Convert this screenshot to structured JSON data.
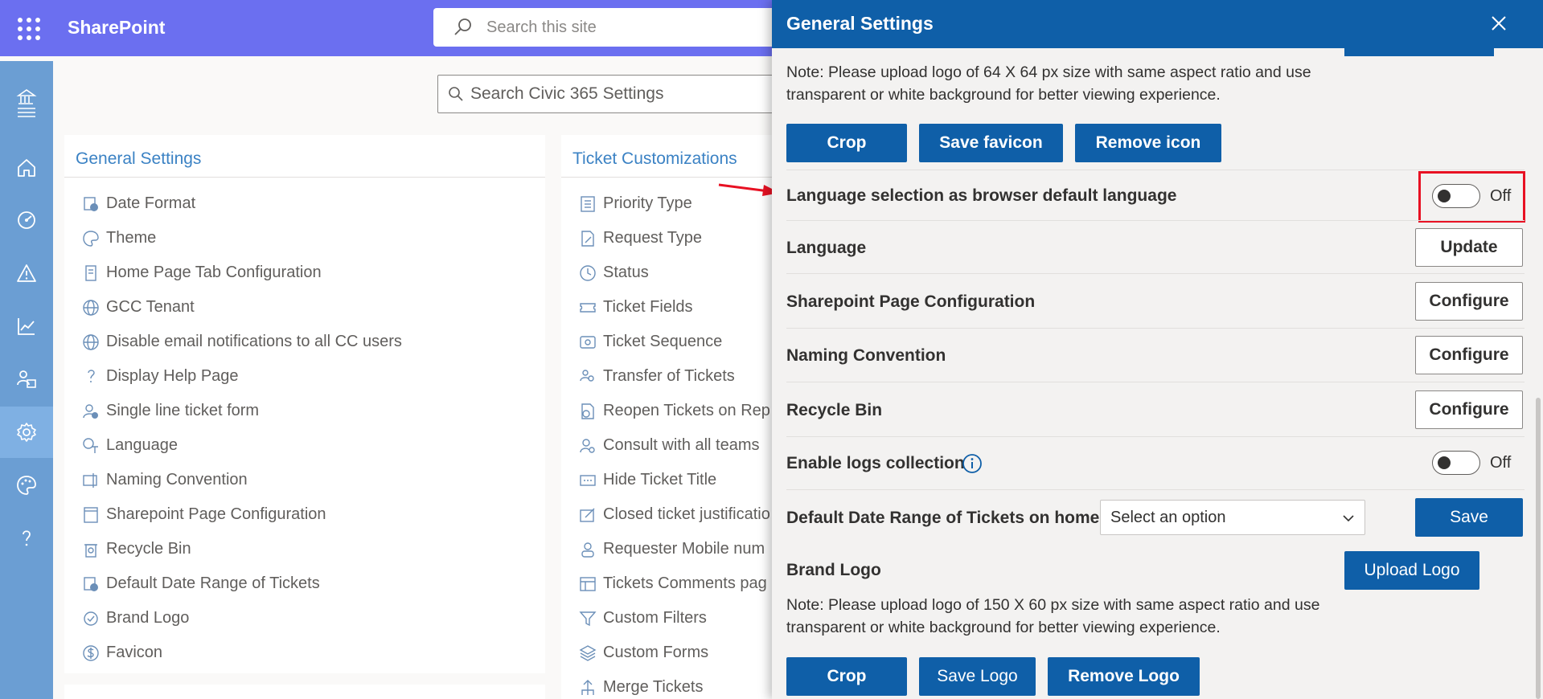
{
  "app": {
    "name": "SharePoint",
    "site_search_placeholder": "Search this site"
  },
  "main": {
    "settings_search_placeholder": "Search Civic 365 Settings",
    "general_card": {
      "title": "General Settings",
      "items": [
        {
          "label": "Date Format",
          "icon": "calendar-clock-icon"
        },
        {
          "label": "Theme",
          "icon": "palette-icon"
        },
        {
          "label": "Home Page Tab Configuration",
          "icon": "document-icon"
        },
        {
          "label": "GCC Tenant",
          "icon": "globe-icon"
        },
        {
          "label": "Disable email notifications to all CC users",
          "icon": "globe-icon"
        },
        {
          "label": "Display Help Page",
          "icon": "question-icon"
        },
        {
          "label": "Single line ticket form",
          "icon": "person-remove-icon"
        },
        {
          "label": "Language",
          "icon": "translate-icon"
        },
        {
          "label": "Naming Convention",
          "icon": "rename-icon"
        },
        {
          "label": "Sharepoint Page Configuration",
          "icon": "page-icon"
        },
        {
          "label": "Recycle Bin",
          "icon": "recycle-icon"
        },
        {
          "label": "Default Date Range of Tickets",
          "icon": "calendar-clock-icon"
        },
        {
          "label": "Brand Logo",
          "icon": "badge-icon"
        },
        {
          "label": "Favicon",
          "icon": "dollar-icon"
        }
      ]
    },
    "ticket_card": {
      "title": "Ticket Customizations",
      "items": [
        {
          "label": "Priority Type",
          "icon": "list-icon"
        },
        {
          "label": "Request Type",
          "icon": "edit-document-icon"
        },
        {
          "label": "Status",
          "icon": "clock-icon"
        },
        {
          "label": "Ticket Fields",
          "icon": "ticket-icon"
        },
        {
          "label": "Ticket Sequence",
          "icon": "number-icon"
        },
        {
          "label": "Transfer of Tickets",
          "icon": "people-swap-icon"
        },
        {
          "label": "Reopen Tickets on Rep",
          "icon": "reopen-icon"
        },
        {
          "label": "Consult with all teams",
          "icon": "person-search-icon"
        },
        {
          "label": "Hide Ticket Title",
          "icon": "dots-box-icon"
        },
        {
          "label": "Closed ticket justificatio",
          "icon": "edit-box-icon"
        },
        {
          "label": "Requester Mobile num",
          "icon": "person-icon"
        },
        {
          "label": "Tickets Comments pag",
          "icon": "table-icon"
        },
        {
          "label": "Custom Filters",
          "icon": "filter-icon"
        },
        {
          "label": "Custom Forms",
          "icon": "layers-icon"
        },
        {
          "label": "Merge Tickets",
          "icon": "merge-icon"
        }
      ]
    }
  },
  "panel": {
    "title": "General Settings",
    "favicon_note": "Note: Please upload logo of 64 X 64 px size with same aspect ratio and use transparent or white background for better viewing experience.",
    "favicon_buttons": {
      "crop": "Crop",
      "save": "Save favicon",
      "remove": "Remove icon"
    },
    "rows": {
      "browser_language": {
        "label": "Language selection as browser default language",
        "toggle": "Off"
      },
      "language": {
        "label": "Language",
        "button": "Update"
      },
      "sharepoint_page": {
        "label": "Sharepoint Page Configuration",
        "button": "Configure"
      },
      "naming_convention": {
        "label": "Naming Convention",
        "button": "Configure"
      },
      "recycle_bin": {
        "label": "Recycle Bin",
        "button": "Configure"
      },
      "logs": {
        "label": "Enable logs collection",
        "toggle": "Off"
      },
      "date_range": {
        "label": "Default Date Range of Tickets on homepage",
        "select": "Select an option",
        "button": "Save"
      }
    },
    "brand_logo": {
      "label": "Brand Logo",
      "upload": "Upload Logo",
      "note": "Note: Please upload logo of 150 X 60 px size with same aspect ratio and use transparent or white background for better viewing experience.",
      "buttons": {
        "crop": "Crop",
        "save": "Save Logo",
        "remove": "Remove Logo"
      }
    }
  },
  "colors": {
    "suite_bar": "#6b6ff0",
    "rail": "#6b9ed3",
    "primary": "#0f5fa8",
    "highlight": "#e81123",
    "link": "#3b82c4"
  }
}
